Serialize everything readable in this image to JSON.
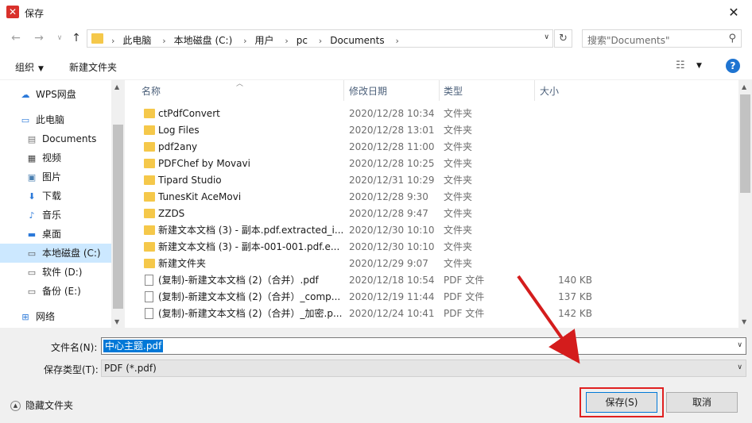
{
  "window": {
    "title": "保存",
    "app_icon": "wps-x-icon",
    "close_label": "✕"
  },
  "address_bar": {
    "crumbs": [
      "此电脑",
      "本地磁盘 (C:)",
      "用户",
      "pc",
      "Documents"
    ],
    "search_placeholder": "搜索\"Documents\""
  },
  "toolbar": {
    "organize_label": "组织",
    "new_folder_label": "新建文件夹",
    "help_label": "?"
  },
  "nav_pane": {
    "items": [
      {
        "label": "WPS网盘",
        "icon": "cloud-icon"
      },
      {
        "label": "此电脑",
        "icon": "computer-icon"
      },
      {
        "label": "Documents",
        "icon": "documents-icon"
      },
      {
        "label": "视频",
        "icon": "video-icon"
      },
      {
        "label": "图片",
        "icon": "picture-icon"
      },
      {
        "label": "下载",
        "icon": "download-icon"
      },
      {
        "label": "音乐",
        "icon": "music-icon"
      },
      {
        "label": "桌面",
        "icon": "desktop-icon"
      },
      {
        "label": "本地磁盘 (C:)",
        "icon": "drive-icon",
        "selected": true
      },
      {
        "label": "软件 (D:)",
        "icon": "drive-icon"
      },
      {
        "label": "备份 (E:)",
        "icon": "drive-icon"
      },
      {
        "label": "网络",
        "icon": "network-icon"
      }
    ]
  },
  "file_list": {
    "columns": {
      "name": "名称",
      "date": "修改日期",
      "type": "类型",
      "size": "大小"
    },
    "rows": [
      {
        "name": "ctPdfConvert",
        "date": "2020/12/28 10:34",
        "type": "文件夹",
        "size": "",
        "kind": "folder"
      },
      {
        "name": "Log Files",
        "date": "2020/12/28 13:01",
        "type": "文件夹",
        "size": "",
        "kind": "folder"
      },
      {
        "name": "pdf2any",
        "date": "2020/12/28 11:00",
        "type": "文件夹",
        "size": "",
        "kind": "folder"
      },
      {
        "name": "PDFChef by Movavi",
        "date": "2020/12/28 10:25",
        "type": "文件夹",
        "size": "",
        "kind": "folder"
      },
      {
        "name": "Tipard Studio",
        "date": "2020/12/31 10:29",
        "type": "文件夹",
        "size": "",
        "kind": "folder"
      },
      {
        "name": "TunesKit AceMovi",
        "date": "2020/12/28 9:30",
        "type": "文件夹",
        "size": "",
        "kind": "folder"
      },
      {
        "name": "ZZDS",
        "date": "2020/12/28 9:47",
        "type": "文件夹",
        "size": "",
        "kind": "folder"
      },
      {
        "name": "新建文本文档 (3) - 副本.pdf.extracted_i...",
        "date": "2020/12/30 10:10",
        "type": "文件夹",
        "size": "",
        "kind": "folder"
      },
      {
        "name": "新建文本文档 (3) - 副本-001-001.pdf.e...",
        "date": "2020/12/30 10:10",
        "type": "文件夹",
        "size": "",
        "kind": "folder"
      },
      {
        "name": "新建文件夹",
        "date": "2020/12/29 9:07",
        "type": "文件夹",
        "size": "",
        "kind": "folder"
      },
      {
        "name": "(复制)-新建文本文档 (2)（合并）.pdf",
        "date": "2020/12/18 10:54",
        "type": "PDF 文件",
        "size": "140 KB",
        "kind": "pdf"
      },
      {
        "name": "(复制)-新建文本文档 (2)（合并）_comp...",
        "date": "2020/12/19 11:44",
        "type": "PDF 文件",
        "size": "137 KB",
        "kind": "pdf"
      },
      {
        "name": "(复制)-新建文本文档 (2)（合并）_加密.p...",
        "date": "2020/12/24 10:41",
        "type": "PDF 文件",
        "size": "142 KB",
        "kind": "pdf"
      }
    ]
  },
  "bottom": {
    "filename_label": "文件名(N):",
    "filename_value": "中心主题.pdf",
    "type_label": "保存类型(T):",
    "type_value": "PDF (*.pdf)",
    "hide_folders_label": "隐藏文件夹",
    "save_label": "保存(S)",
    "cancel_label": "取消"
  },
  "colors": {
    "accent": "#0078d7",
    "annotation_red": "#e02020",
    "folder": "#f5c84a"
  }
}
